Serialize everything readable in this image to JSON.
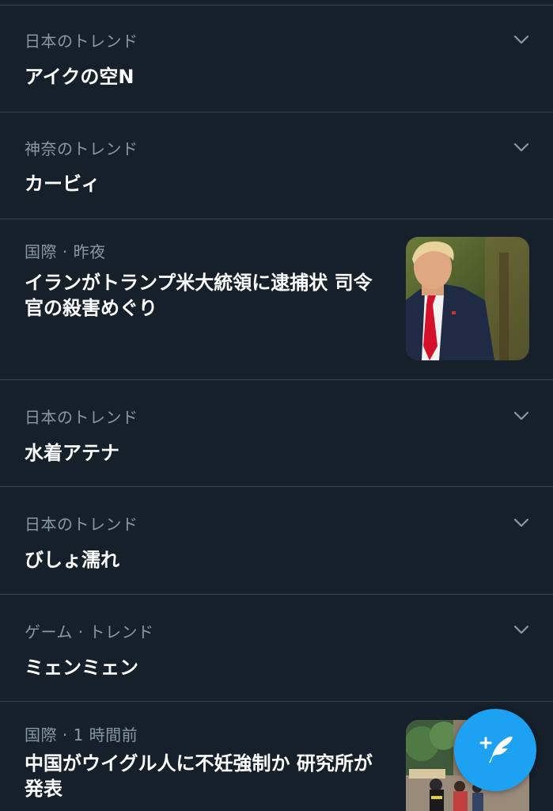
{
  "trends": [
    {
      "meta": "日本のトレンド",
      "title": "アイクの空N",
      "has_menu": true
    },
    {
      "meta": "神奈のトレンド",
      "title": "カービィ",
      "has_menu": true
    },
    {
      "meta": "国際 · 昨夜",
      "title": "イランがトランプ米大統領に逮捕状 司令官の殺害めぐり",
      "has_image": true,
      "image_icon": "portrait-photo"
    },
    {
      "meta": "日本のトレンド",
      "title": "水着アテナ",
      "has_menu": true
    },
    {
      "meta": "日本のトレンド",
      "title": "びしょ濡れ",
      "has_menu": true
    },
    {
      "meta": "ゲーム · トレンド",
      "title": "ミェンミェン",
      "has_menu": true
    },
    {
      "meta": "国際 · 1 時間前",
      "title": "中国がウイグル人に不妊強制か 研究所が発表",
      "has_image": true,
      "image_icon": "street-crowd-photo"
    }
  ],
  "compose_button": {
    "icon": "feather-plus-icon"
  },
  "colors": {
    "background": "#15202b",
    "divider": "#38444d",
    "secondary_text": "#8899a6",
    "primary_text": "#ffffff",
    "accent": "#1da1f2"
  }
}
